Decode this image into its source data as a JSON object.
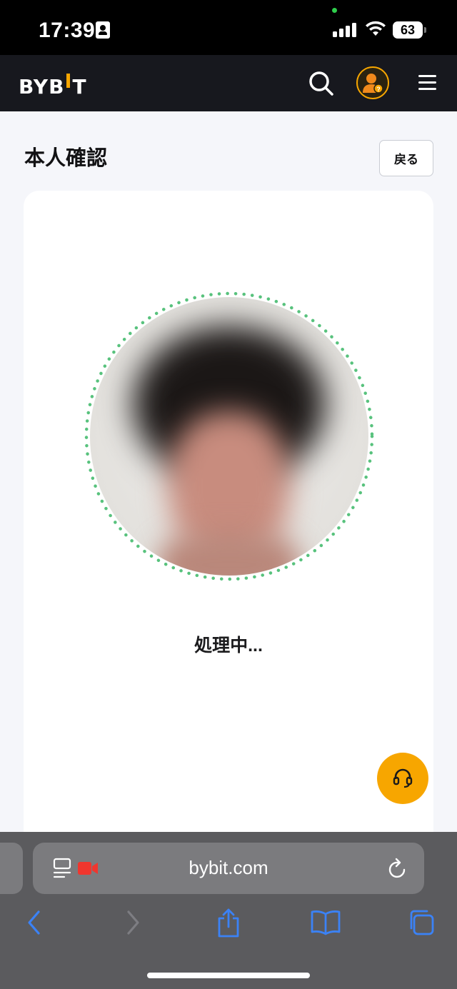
{
  "status_bar": {
    "time": "17:39",
    "battery": "63"
  },
  "header": {
    "logo_text_left": "BYB",
    "logo_text_right": "T"
  },
  "page": {
    "title": "本人確認",
    "back_label": "戻る"
  },
  "verification": {
    "status_text": "処理中..."
  },
  "browser": {
    "url": "bybit.com"
  },
  "colors": {
    "brand": "#f7a600",
    "ring": "#58c27d",
    "header_bg": "#17181e",
    "browser_accent": "#3b82f6"
  },
  "icons": {
    "search": "search-icon",
    "avatar": "avatar-icon",
    "menu": "hamburger-menu-icon",
    "support": "headset-icon",
    "back_nav": "chevron-left-icon",
    "forward_nav": "chevron-right-icon",
    "share": "share-icon",
    "bookmarks": "book-icon",
    "tabs": "tabs-icon",
    "reader": "reader-icon",
    "recording": "video-camera-icon",
    "reload": "reload-icon"
  }
}
